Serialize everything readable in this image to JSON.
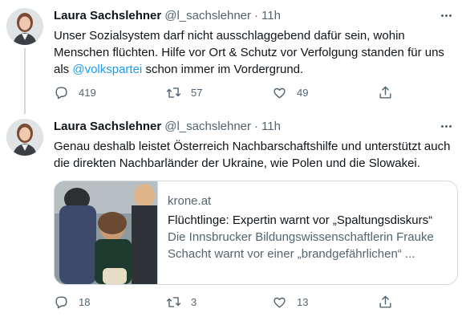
{
  "tweets": [
    {
      "author_name": "Laura Sachslehner",
      "handle": "@l_sachslehner",
      "separator": "·",
      "time": "11h",
      "text_part1": "Unser Sozialsystem darf nicht ausschlaggebend dafür sein, wohin Menschen flüchten. Hilfe vor Ort & Schutz vor Verfolgung standen für uns als ",
      "mention": "@volkspartei",
      "text_part2": " schon immer im Vordergrund.",
      "replies": "419",
      "retweets": "57",
      "likes": "49"
    },
    {
      "author_name": "Laura Sachslehner",
      "handle": "@l_sachslehner",
      "separator": "·",
      "time": "11h",
      "text": "Genau deshalb leistet Österreich Nachbarschaftshilfe und unterstützt auch die direkten Nachbarländer der Ukraine, wie Polen und die Slowakei.",
      "card": {
        "domain": "krone.at",
        "title": "Flüchtlinge: Expertin warnt vor „Spaltungsdiskurs“",
        "description": "Die Innsbrucker Bildungswissenschaftlerin Frauke Schacht warnt vor einer „brandgefährlichen“ ..."
      },
      "replies": "18",
      "retweets": "3",
      "likes": "13"
    }
  ],
  "icons": {
    "reply": "reply-icon",
    "retweet": "retweet-icon",
    "like": "heart-icon",
    "share": "share-icon",
    "more": "more-icon"
  },
  "colors": {
    "text": "#0f1419",
    "secondary": "#536471",
    "link": "#1d9bf0",
    "border": "#cfd9de"
  }
}
